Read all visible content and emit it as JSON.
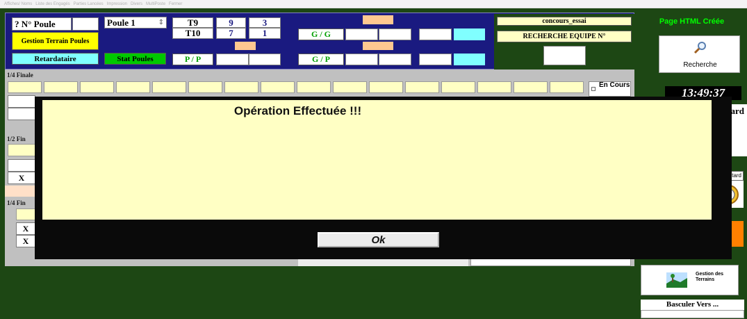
{
  "menu": [
    "Affiches/ Noms",
    "Liste des Engagés",
    "Parties Lancées",
    "Impression",
    "Divers",
    "MultiPoste",
    "Fermer"
  ],
  "poule": {
    "label": "? N° Poule",
    "select": "Poule 1",
    "select_arrow": "⇕",
    "gestion_terrain": "Gestion Terrain Poules",
    "retardataire": "Retardataire",
    "stat_poules": "Stat Poules"
  },
  "terrains": [
    {
      "name": "T9",
      "a": "9",
      "b": "3"
    },
    {
      "name": "T10",
      "a": "7",
      "b": "1"
    }
  ],
  "scores": {
    "gg": "G / G",
    "pp": "P / P",
    "gp": "G / P"
  },
  "search": {
    "concours": "concours_essai",
    "recherche_equipe": "RECHERCHE EQUIPE N°"
  },
  "right": {
    "page_html": "Page HTML Créée",
    "recherche": "Recherche",
    "time": "13:49:37",
    "retard_partial": "tard",
    "retard_small": "etard",
    "gestion_terrains": "Gestion des Terrains",
    "basculer": "Basculer Vers ..."
  },
  "sections": {
    "quart1": "1/4 Finale",
    "demi": "1/2 Fin",
    "quart2": "1/4 Fin",
    "en_cours": "En Cours",
    "x": "X"
  },
  "modal": {
    "message": "Opération Effectuée !!!",
    "ok": "Ok"
  },
  "colors": {
    "navy": "#1a1a80",
    "green": "#1d4714",
    "yellow": "#ffff00",
    "cyan": "#80ffff",
    "peach": "#ffc890",
    "lime": "#00c800",
    "cream": "#ffffc4",
    "orange": "#ff8000"
  }
}
